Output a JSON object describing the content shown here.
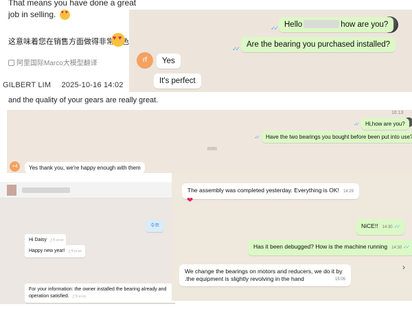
{
  "panel1": {
    "message_en": "That means you have done a great job in selling.",
    "message_cn": "这意味着您在销售方面做得非常出色。",
    "translation_note": "阿里国际Marco大模型翻译",
    "emoji_icon": "heart-eyes-emoji-icon"
  },
  "sender": {
    "name": "GILBERT LIM",
    "timestamp": "2025-10-16 14:02"
  },
  "panel1b": {
    "message": "and the quality of your gears are really great."
  },
  "panel2": {
    "hello_prefix": "Hello",
    "hello_suffix": "how are you?",
    "question": "Are the bearing you purchased installed?",
    "avatar_initials": "rf",
    "reply_yes": "Yes",
    "reply_perfect": "It's perfect"
  },
  "panel3": {
    "time": "16:13",
    "out_1": "Hi,how are you?",
    "out_2": "Have the two bearings you bought before been put into use?",
    "avatar_initials": "+4",
    "in_1": "Yes thank you, we're happy enough with them",
    "watermark": "RIRI"
  },
  "panel4": {
    "out_1": "수쯔",
    "in_1": "Hi Daisy",
    "in_2": "Happy new year!",
    "in_3": "For your information: the owner installed the bearing already and operation satisfied.",
    "stamp_1": "上午10:03",
    "stamp_2": "上午10:03",
    "stamp_3": "上午10:03"
  },
  "panel5": {
    "m1": "The assembly was completed yesterday. Everything is OK!",
    "m1_time": "14:29",
    "m2": "NiCE!!",
    "m2_time": "14:30",
    "m3": "Has it been debugged? How is the machine running",
    "m3_time": "14:30",
    "m4": "We change the bearings on motors and reducers, we do it by .the equipment is slightly revolving in the hand",
    "m4_time": "15:05"
  },
  "colors": {
    "whatsapp_bg": "#efe8dd",
    "outgoing_bubble": "#dcf8c6",
    "incoming_bubble": "#ffffff",
    "read_tick": "#4fb6ec",
    "avatar_orange": "#f4a261"
  }
}
